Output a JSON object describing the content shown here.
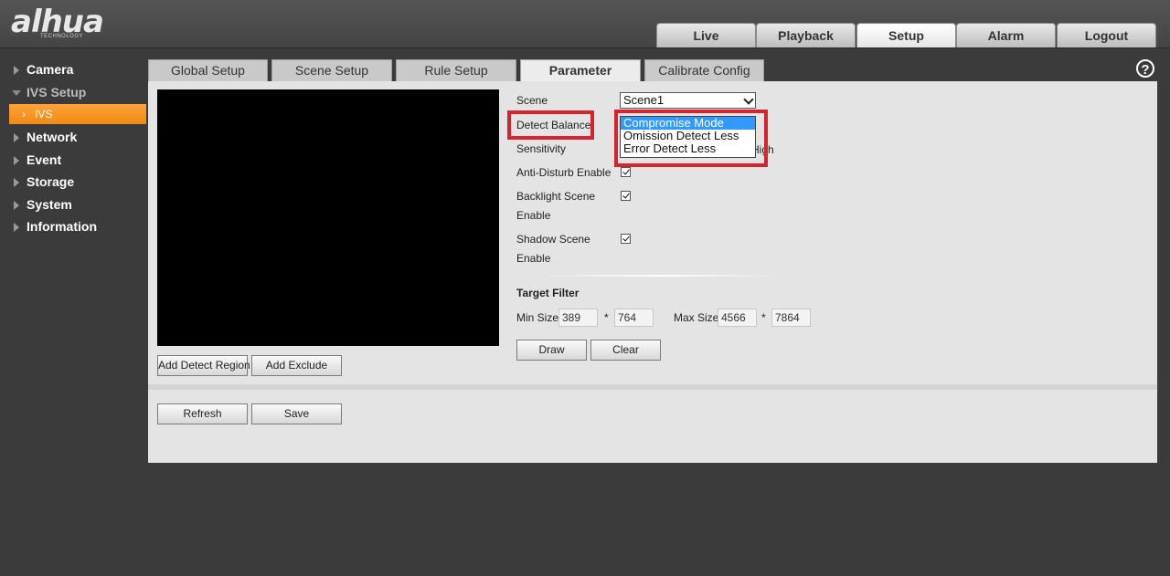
{
  "brand": {
    "logo_text": "alhua",
    "logo_sub": "TECHNOLOGY"
  },
  "topnav": [
    "Live",
    "Playback",
    "Setup",
    "Alarm",
    "Logout"
  ],
  "topnav_active": "Setup",
  "sidebar": {
    "items": [
      "Camera",
      "IVS Setup",
      "Network",
      "Event",
      "Storage",
      "System",
      "Information"
    ],
    "active_sub": "IVS"
  },
  "subtabs": [
    "Global Setup",
    "Scene Setup",
    "Rule Setup",
    "Parameter",
    "Calibrate Config"
  ],
  "subtab_active": "Parameter",
  "help": "?",
  "form": {
    "scene_label": "Scene",
    "scene_value": "Scene1",
    "detect_balance_label": "Detect Balance",
    "detect_balance_options": [
      "Compromise Mode",
      "Omission Detect Less",
      "Error Detect Less"
    ],
    "detect_balance_selected": "Compromise Mode",
    "sensitivity_label": "Sensitivity",
    "sensitivity_partial": "High",
    "anti_disturb_label": "Anti-Disturb Enable",
    "backlight_label_1": "Backlight Scene",
    "backlight_label_2": "Enable",
    "shadow_label_1": "Shadow Scene",
    "shadow_label_2": "Enable",
    "target_filter_label": "Target Filter",
    "min_size_label": "Min Size",
    "min_w": "389",
    "min_h": "764",
    "max_size_label": "Max Size",
    "max_w": "4566",
    "max_h": "7864",
    "times": "*",
    "draw": "Draw",
    "clear": "Clear"
  },
  "buttons": {
    "add_detect_region": "Add Detect Region",
    "add_exclude": "Add Exclude",
    "refresh": "Refresh",
    "save": "Save"
  },
  "colors": {
    "highlight_red": "#d3242f",
    "active_orange": "#f08a14",
    "selection_blue": "#3399ff"
  }
}
